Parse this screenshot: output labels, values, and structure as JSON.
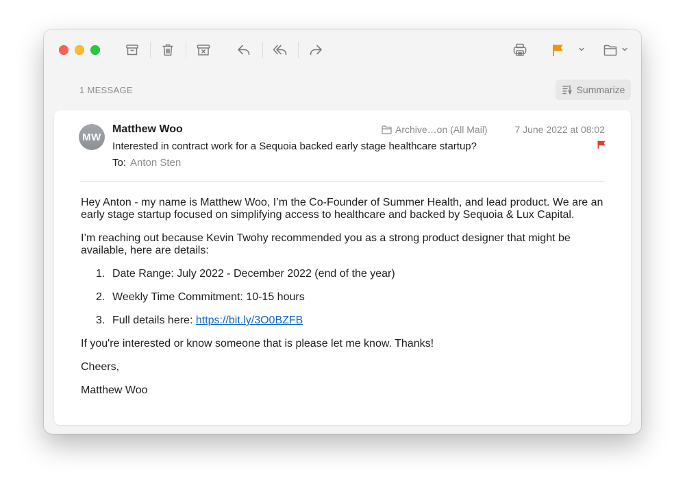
{
  "toolbar": {
    "icons": [
      "archive-icon",
      "trash-icon",
      "junk-icon",
      "reply-icon",
      "reply-all-icon",
      "forward-icon",
      "print-icon",
      "flag-icon",
      "folder-icon"
    ],
    "flag_color": "#f2930d"
  },
  "thread": {
    "count_label": "1 MESSAGE",
    "summarize_label": "Summarize"
  },
  "message": {
    "avatar_initials": "MW",
    "sender": "Matthew Woo",
    "subject": "Interested in contract work for a Sequoia backed early stage healthcare startup?",
    "to_label": "To:",
    "recipient": "Anton Sten",
    "mailbox": "Archive…on (All Mail)",
    "date": "7 June 2022 at 08:02",
    "flag_color": "#e8382f",
    "body": {
      "p1": "Hey Anton - my name is Matthew Woo, I’m the Co-Founder of Summer Health, and lead product. We are an early stage startup focused on simplifying access to healthcare and backed by Sequoia & Lux Capital.",
      "p2": "I’m reaching out because Kevin Twohy recommended you as a strong product designer that might be available, here are details:",
      "list": [
        {
          "num": "1.",
          "text": "Date Range: July 2022 - December 2022 (end of the year)"
        },
        {
          "num": "2.",
          "text": "Weekly Time Commitment: 10-15 hours"
        },
        {
          "num": "3.",
          "text": "Full details here: ",
          "link": "https://bit.ly/3O0BZFB"
        }
      ],
      "p3": "If you're interested or know someone that is please let me know. Thanks!",
      "p4": "Cheers,",
      "signature": "Matthew Woo"
    }
  }
}
